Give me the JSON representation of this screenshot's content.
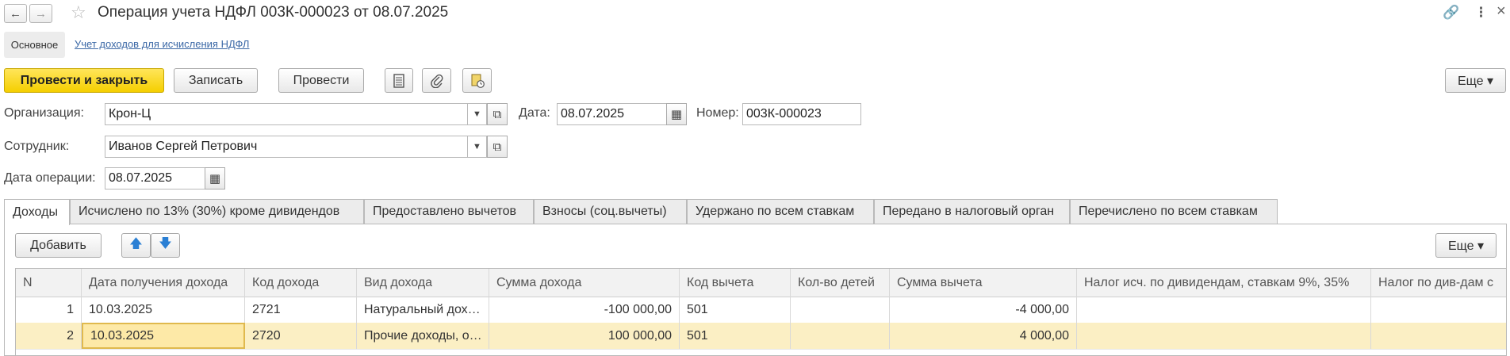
{
  "window": {
    "title": "Операция учета НДФЛ 003К-000023 от 08.07.2025",
    "back_icon": "←",
    "forward_icon": "→",
    "favorite_icon": "☆",
    "link_icon": "🔗",
    "more_icon": "⋮",
    "close_icon": "×"
  },
  "sections": {
    "main": "Основное",
    "link": "Учет доходов для исчисления НДФЛ"
  },
  "toolbar": {
    "post_close": "Провести и закрыть",
    "save": "Записать",
    "post": "Провести",
    "more": "Еще ▾"
  },
  "form": {
    "org_label": "Организация:",
    "org_value": "Крон-Ц",
    "date_label": "Дата:",
    "date_value": "08.07.2025",
    "number_label": "Номер:",
    "number_value": "003К-000023",
    "employee_label": "Сотрудник:",
    "employee_value": "Иванов Сергей Петрович",
    "op_date_label": "Дата операции:",
    "op_date_value": "08.07.2025"
  },
  "tabs": [
    "Доходы",
    "Исчислено по 13% (30%) кроме дивидендов",
    "Предоставлено вычетов",
    "Взносы (соц.вычеты)",
    "Удержано по всем ставкам",
    "Передано в налоговый орган",
    "Перечислено по всем ставкам"
  ],
  "table_toolbar": {
    "add": "Добавить",
    "up_icon": "🡅",
    "down_icon": "🡇",
    "more": "Еще ▾"
  },
  "table": {
    "columns": [
      "N",
      "Дата получения дохода",
      "Код дохода",
      "Вид дохода",
      "Сумма дохода",
      "Код вычета",
      "Кол-во детей",
      "Сумма вычета",
      "Налог исч. по дивидендам, ставкам 9%, 35%",
      "Налог по див-дам с"
    ],
    "rows": [
      [
        "1",
        "10.03.2025",
        "2721",
        "Натуральный дох…",
        "-100 000,00",
        "501",
        "",
        "-4 000,00",
        "",
        ""
      ],
      [
        "2",
        "10.03.2025",
        "2720",
        "Прочие доходы, о…",
        "100 000,00",
        "501",
        "",
        "4 000,00",
        "",
        ""
      ]
    ]
  },
  "colors": {
    "accent_yellow": "#f5cf00",
    "selected_row": "#fbefc4",
    "link": "#3b68a6"
  }
}
